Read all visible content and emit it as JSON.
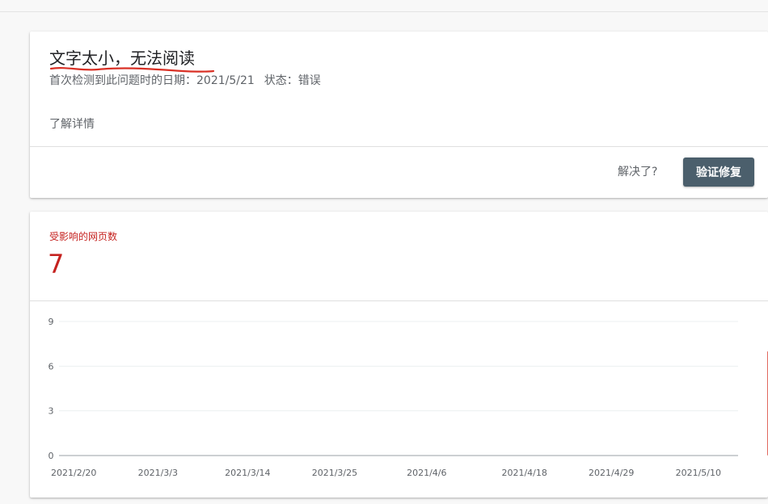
{
  "issue": {
    "title": "文字太小，无法阅读",
    "first_detected_label": "首次检测到此问题时的日期：",
    "first_detected_value": "2021/5/21",
    "status_label": "状态：",
    "status_value": "错误",
    "learn_more": "了解详情",
    "resolved_prompt": "解决了?",
    "verify_button": "验证修复"
  },
  "metric": {
    "label": "受影响的网页数",
    "value": "7",
    "color": "#c5221f"
  },
  "chart_data": {
    "type": "bar",
    "x_tick_labels": [
      "2021/2/20",
      "2021/3/3",
      "2021/3/14",
      "2021/3/25",
      "2021/4/6",
      "2021/4/18",
      "2021/4/29",
      "2021/5/10"
    ],
    "y_ticks": [
      0,
      3,
      6,
      9
    ],
    "ylim": [
      0,
      9
    ],
    "series": [
      {
        "values": [
          {
            "x": "2021/5/21",
            "y": 7
          }
        ],
        "color": "#db4437"
      }
    ],
    "grid": true
  }
}
